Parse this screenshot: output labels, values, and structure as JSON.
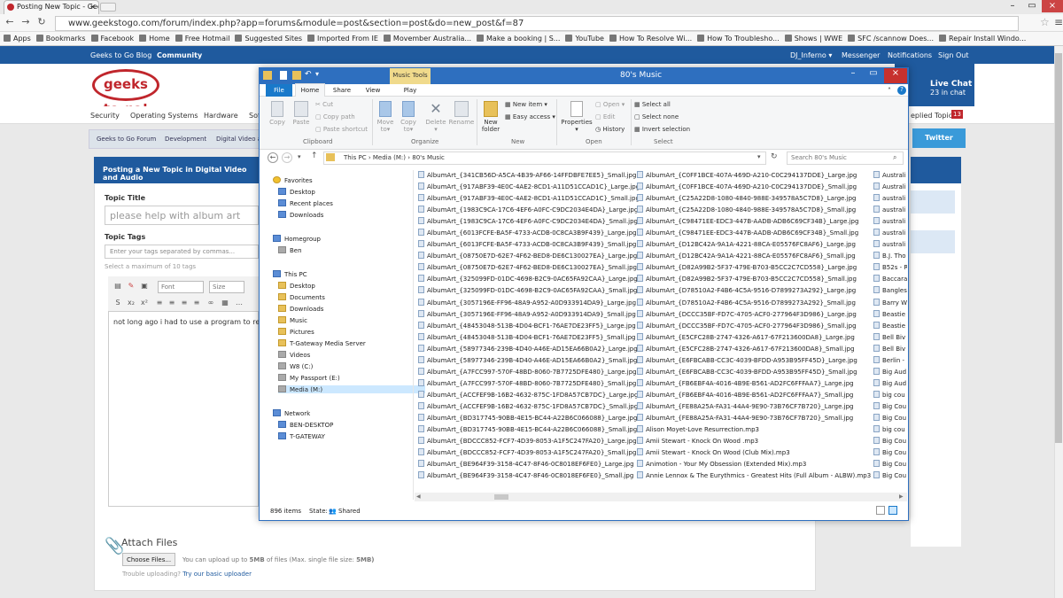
{
  "browser": {
    "tab_title": "Posting New Topic - Geek",
    "url": "www.geekstogo.com/forum/index.php?app=forums&module=post&section=post&do=new_post&f=87",
    "bookmarks": [
      "Apps",
      "Bookmarks",
      "Facebook",
      "Home",
      "Free Hotmail",
      "Suggested Sites",
      "Imported From IE",
      "Movember Australia...",
      "Make a booking | S...",
      "YouTube",
      "How To Resolve Wi...",
      "How To Troublesho...",
      "Shows | WWE",
      "SFC /scannow Does...",
      "Repair Install Windo..."
    ]
  },
  "site": {
    "topnav": {
      "blog": "Geeks to Go Blog",
      "community": "Community",
      "user": "DJ_Inferno ▾",
      "messenger": "Messenger",
      "notifications": "Notifications",
      "signout": "Sign Out"
    },
    "logo_text": "geeks to go!",
    "livechat": {
      "title": "Live Chat",
      "subtitle": "23 in chat",
      "left": "ds"
    },
    "subnav": [
      "Security",
      "Operating Systems",
      "Hardware",
      "Sof"
    ],
    "replied_topics": "eplied Topics",
    "replied_count": "13",
    "breadcrumb": [
      "Geeks to Go Forum",
      "Development",
      "Digital Video ar"
    ],
    "twitter": "Twitter",
    "form": {
      "heading": "Posting a New Topic in Digital Video and Audio",
      "topic_title_label": "Topic Title",
      "topic_title_value": "please help with album art",
      "topic_tags_label": "Topic Tags",
      "topic_tags_placeholder": "Enter your tags separated by commas...",
      "tags_hint": "Select a maximum of 10 tags",
      "font_select": "Font",
      "size_select": "Size",
      "body_text": "not long ago i had to use a program to re",
      "attach_title": "Attach Files",
      "choose_button": "Choose Files...",
      "upload_hint_prefix": "You can upload up to",
      "upload_hint_bold": "5MB",
      "upload_hint_suffix": "of files (Max. single file size:",
      "upload_max": "5MB)",
      "trouble_prefix": "Trouble uploading?",
      "trouble_link": "Try our basic uploader"
    }
  },
  "explorer": {
    "title": "80's Music",
    "music_tools": "Music Tools",
    "tabs": [
      "File",
      "Home",
      "Share",
      "View",
      "Play"
    ],
    "ribbon": {
      "clipboard": {
        "label": "Clipboard",
        "copy": "Copy",
        "paste": "Paste",
        "cut": "Cut",
        "copy_path": "Copy path",
        "paste_shortcut": "Paste shortcut"
      },
      "organize": {
        "label": "Organize",
        "move_to": "Move to▾",
        "copy_to": "Copy to▾",
        "delete": "Delete ▾",
        "rename": "Rename"
      },
      "new": {
        "label": "New",
        "new_folder": "New folder",
        "new_item": "New item ▾",
        "easy_access": "Easy access ▾"
      },
      "open": {
        "label": "Open",
        "properties": "Properties ▾",
        "open": "Open ▾",
        "edit": "Edit",
        "history": "History"
      },
      "select": {
        "label": "Select",
        "select_all": "Select all",
        "select_none": "Select none",
        "invert": "Invert selection"
      }
    },
    "path": [
      "This PC",
      "Media (M:)",
      "80's Music"
    ],
    "search_placeholder": "Search 80's Music",
    "nav": {
      "favorites": "Favorites",
      "fav_items": [
        "Desktop",
        "Recent places",
        "Downloads"
      ],
      "homegroup": "Homegroup",
      "hg_items": [
        "Ben"
      ],
      "thispc": "This PC",
      "pc_items": [
        "Desktop",
        "Documents",
        "Downloads",
        "Music",
        "Pictures",
        "T-Gateway Media Server",
        "Videos",
        "W8 (C:)",
        "My Passport (E:)",
        "Media (M:)"
      ],
      "network": "Network",
      "net_items": [
        "BEN-DESKTOP",
        "T-GATEWAY"
      ]
    },
    "files_col1": [
      "AlbumArt_{341CB56D-A5CA-4B39-AF66-14FFDBFE7EE5}_Small.jpg",
      "AlbumArt_{917ABF39-4E0C-4AE2-8CD1-A11D51CCAD1C}_Large.jpg",
      "AlbumArt_{917ABF39-4E0C-4AE2-8CD1-A11D51CCAD1C}_Small.jpg",
      "AlbumArt_{1983C9CA-17C6-4EF6-A0FC-C9DC2034E4DA}_Large.jpg",
      "AlbumArt_{1983C9CA-17C6-4EF6-A0FC-C9DC2034E4DA}_Small.jpg",
      "AlbumArt_{6013FCFE-BA5F-4733-ACDB-0C8CA3B9F439}_Large.jpg",
      "AlbumArt_{6013FCFE-BA5F-4733-ACDB-0C8CA3B9F439}_Small.jpg",
      "AlbumArt_{08750E7D-62E7-4F62-BED8-DE6C130027EA}_Large.jpg",
      "AlbumArt_{08750E7D-62E7-4F62-BED8-DE6C130027EA}_Small.jpg",
      "AlbumArt_{325099FD-01DC-4698-B2C9-0AC65FA92CAA}_Large.jpg",
      "AlbumArt_{325099FD-01DC-4698-B2C9-0AC65FA92CAA}_Small.jpg",
      "AlbumArt_{3057196E-FF96-48A9-A952-A0D933914DA9}_Large.jpg",
      "AlbumArt_{3057196E-FF96-48A9-A952-A0D933914DA9}_Small.jpg",
      "AlbumArt_{48453048-513B-4D04-BCF1-76AE7DE23FF5}_Large.jpg",
      "AlbumArt_{48453048-513B-4D04-BCF1-76AE7DE23FF5}_Small.jpg",
      "AlbumArt_{58977346-239B-4D40-A46E-AD15EA66B0A2}_Large.jpg",
      "AlbumArt_{58977346-239B-4D40-A46E-AD15EA66B0A2}_Small.jpg",
      "AlbumArt_{A7FCC997-570F-48BD-8060-7B7725DFE480}_Large.jpg",
      "AlbumArt_{A7FCC997-570F-48BD-8060-7B7725DFE480}_Small.jpg",
      "AlbumArt_{ACCFEF9B-16B2-4632-875C-1FD8A57CB7DC}_Large.jpg",
      "AlbumArt_{ACCFEF9B-16B2-4632-875C-1FD8A57CB7DC}_Small.jpg",
      "AlbumArt_{BD317745-90BB-4E15-BC44-A22B6C066088}_Large.jpg",
      "AlbumArt_{BD317745-90BB-4E15-BC44-A22B6C066088}_Small.jpg",
      "AlbumArt_{BDCCC852-FCF7-4D39-8053-A1F5C247FA20}_Large.jpg",
      "AlbumArt_{BDCCC852-FCF7-4D39-8053-A1F5C247FA20}_Small.jpg",
      "AlbumArt_{BE964F39-3158-4C47-8F46-0C8018EF6FE0}_Large.jpg",
      "AlbumArt_{BE964F39-3158-4C47-8F46-0C8018EF6FE0}_Small.jpg"
    ],
    "files_col2": [
      "AlbumArt_{C0FF1BCE-407A-469D-A210-C0C294137DDE}_Large.jpg",
      "AlbumArt_{C0FF1BCE-407A-469D-A210-C0C294137DDE}_Small.jpg",
      "AlbumArt_{C25A22D8-1080-4840-988E-349578A5C7D8}_Large.jpg",
      "AlbumArt_{C25A22D8-1080-4840-988E-349578A5C7D8}_Small.jpg",
      "AlbumArt_{C98471EE-EDC3-447B-AADB-ADB6C69CF34B}_Large.jpg",
      "AlbumArt_{C98471EE-EDC3-447B-AADB-ADB6C69CF34B}_Small.jpg",
      "AlbumArt_{D12BC42A-9A1A-4221-88CA-E05576FC8AF6}_Large.jpg",
      "AlbumArt_{D12BC42A-9A1A-4221-88CA-E05576FC8AF6}_Small.jpg",
      "AlbumArt_{D82A99B2-5F37-479E-B703-B5CC2C7CD558}_Large.jpg",
      "AlbumArt_{D82A99B2-5F37-479E-B703-B5CC2C7CD558}_Small.jpg",
      "AlbumArt_{D78510A2-F4B6-4C5A-9516-D7899273A292}_Large.jpg",
      "AlbumArt_{D78510A2-F4B6-4C5A-9516-D7899273A292}_Small.jpg",
      "AlbumArt_{DCCC35BF-FD7C-4705-ACF0-277964F3D986}_Large.jpg",
      "AlbumArt_{DCCC35BF-FD7C-4705-ACF0-277964F3D986}_Small.jpg",
      "AlbumArt_{E5CFC28B-2747-4326-A617-67F213600DA8}_Large.jpg",
      "AlbumArt_{E5CFC28B-2747-4326-A617-67F213600DA8}_Small.jpg",
      "AlbumArt_{E6FBCABB-CC3C-4039-BFDD-A953B95FF45D}_Large.jpg",
      "AlbumArt_{E6FBCABB-CC3C-4039-BFDD-A953B95FF45D}_Small.jpg",
      "AlbumArt_{FB6EBF4A-4016-4B9E-B561-AD2FC6FFFAA7}_Large.jpg",
      "AlbumArt_{FB6EBF4A-4016-4B9E-B561-AD2FC6FFFAA7}_Small.jpg",
      "AlbumArt_{FE88A25A-FA31-44A4-9E90-73B76CF7B720}_Large.jpg",
      "AlbumArt_{FE88A25A-FA31-44A4-9E90-73B76CF7B720}_Small.jpg",
      "Alison Moyet-Love Resurrection.mp3",
      "Amii Stewart - Knock On Wood .mp3",
      "Amii Stewart - Knock On Wood (Club Mix).mp3",
      "Animotion - Your My Obsession (Extended Mix).mp3",
      "Annie Lennox & The Eurythmics - Greatest Hits (Full Album - ALBW).mp3"
    ],
    "files_col3": [
      "Australi",
      "Australi",
      "australi",
      "australi",
      "australi",
      "australi",
      "australi",
      "B.J. Tho",
      "B52s - R",
      "Baccara",
      "Bangles",
      "Barry W",
      "Beastie",
      "Beastie",
      "Bell Biv",
      "Bell Biv",
      "Berlin -",
      "Big Aud",
      "Big Aud",
      "big cou",
      "Big Cou",
      "Big Cou",
      "big cou",
      "Big Cou",
      "Big Cou",
      "Big Cou",
      "Big Cou"
    ],
    "status_items": "896 items",
    "status_state": "State:",
    "status_shared": "Shared"
  }
}
